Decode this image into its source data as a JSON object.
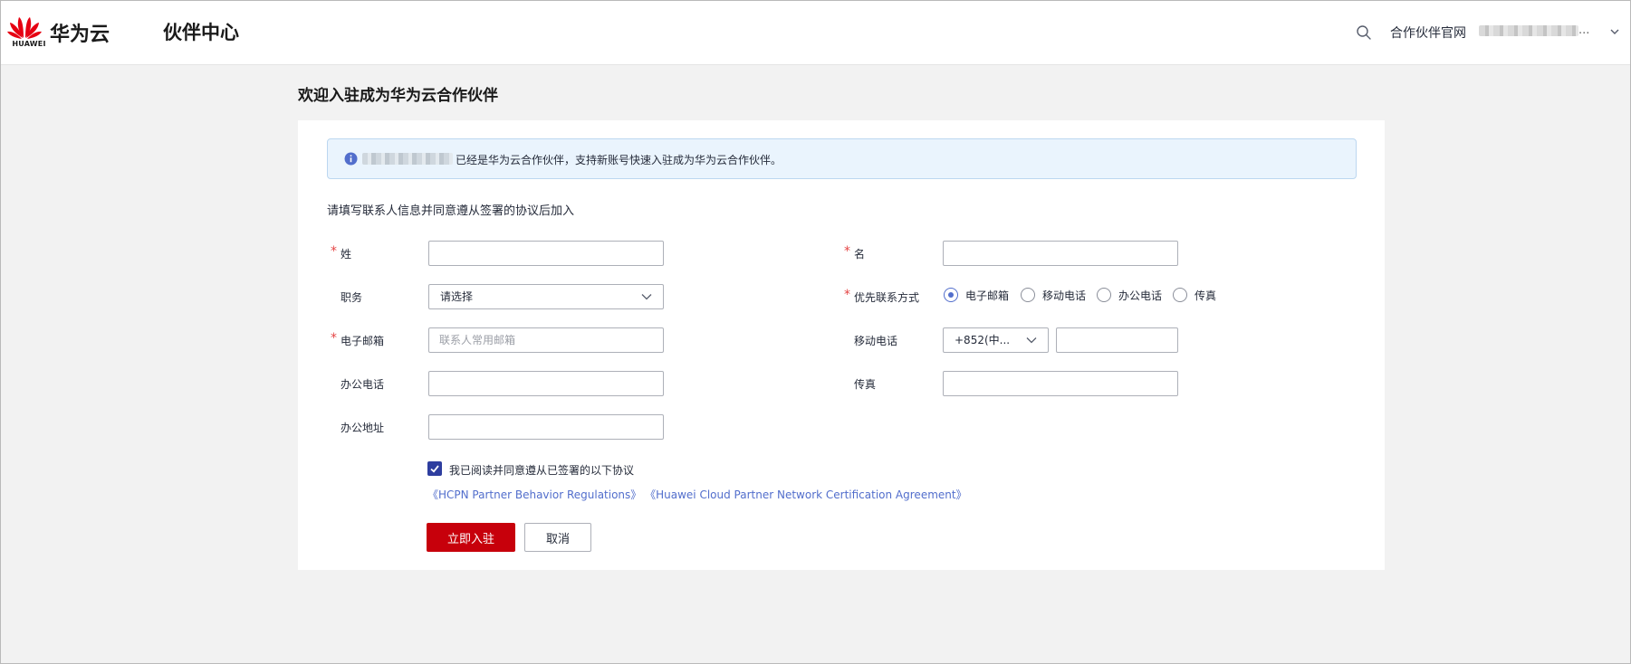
{
  "header": {
    "logo_text": "HUAWEI",
    "brand": "华为云",
    "app_title": "伙伴中心",
    "partner_site_label": "合作伙伴官网",
    "account_suffix": "..."
  },
  "page": {
    "heading": "欢迎入驻成为华为云合作伙伴",
    "notice_message": "已经是华为云合作伙伴，支持新账号快速入驻成为华为云合作伙伴。",
    "section_tip": "请填写联系人信息并同意遵从签署的协议后加入"
  },
  "form": {
    "last_name": {
      "label": "姓",
      "value": ""
    },
    "first_name": {
      "label": "名",
      "value": ""
    },
    "position": {
      "label": "职务",
      "selected": "请选择"
    },
    "contact_method": {
      "label": "优先联系方式",
      "options": [
        "电子邮箱",
        "移动电话",
        "办公电话",
        "传真"
      ],
      "selected": "电子邮箱"
    },
    "email": {
      "label": "电子邮箱",
      "placeholder": "联系人常用邮箱",
      "value": ""
    },
    "mobile": {
      "label": "移动电话",
      "country_code": "+852(中...",
      "value": ""
    },
    "office_phone": {
      "label": "办公电话",
      "value": ""
    },
    "fax": {
      "label": "传真",
      "value": ""
    },
    "office_address": {
      "label": "办公地址",
      "value": ""
    },
    "agreement": {
      "checked": true,
      "text": "我已阅读并同意遵从已签署的以下协议",
      "link1": "《HCPN Partner Behavior Regulations》",
      "link2": "《Huawei Cloud Partner Network Certification Agreement》"
    },
    "submit_label": "立即入驻",
    "cancel_label": "取消"
  },
  "colors": {
    "primary": "#c7000b",
    "link": "#526ecc",
    "checkbox": "#2e3e9f",
    "required": "#e54545",
    "notice_bg": "#eaf4fd"
  }
}
